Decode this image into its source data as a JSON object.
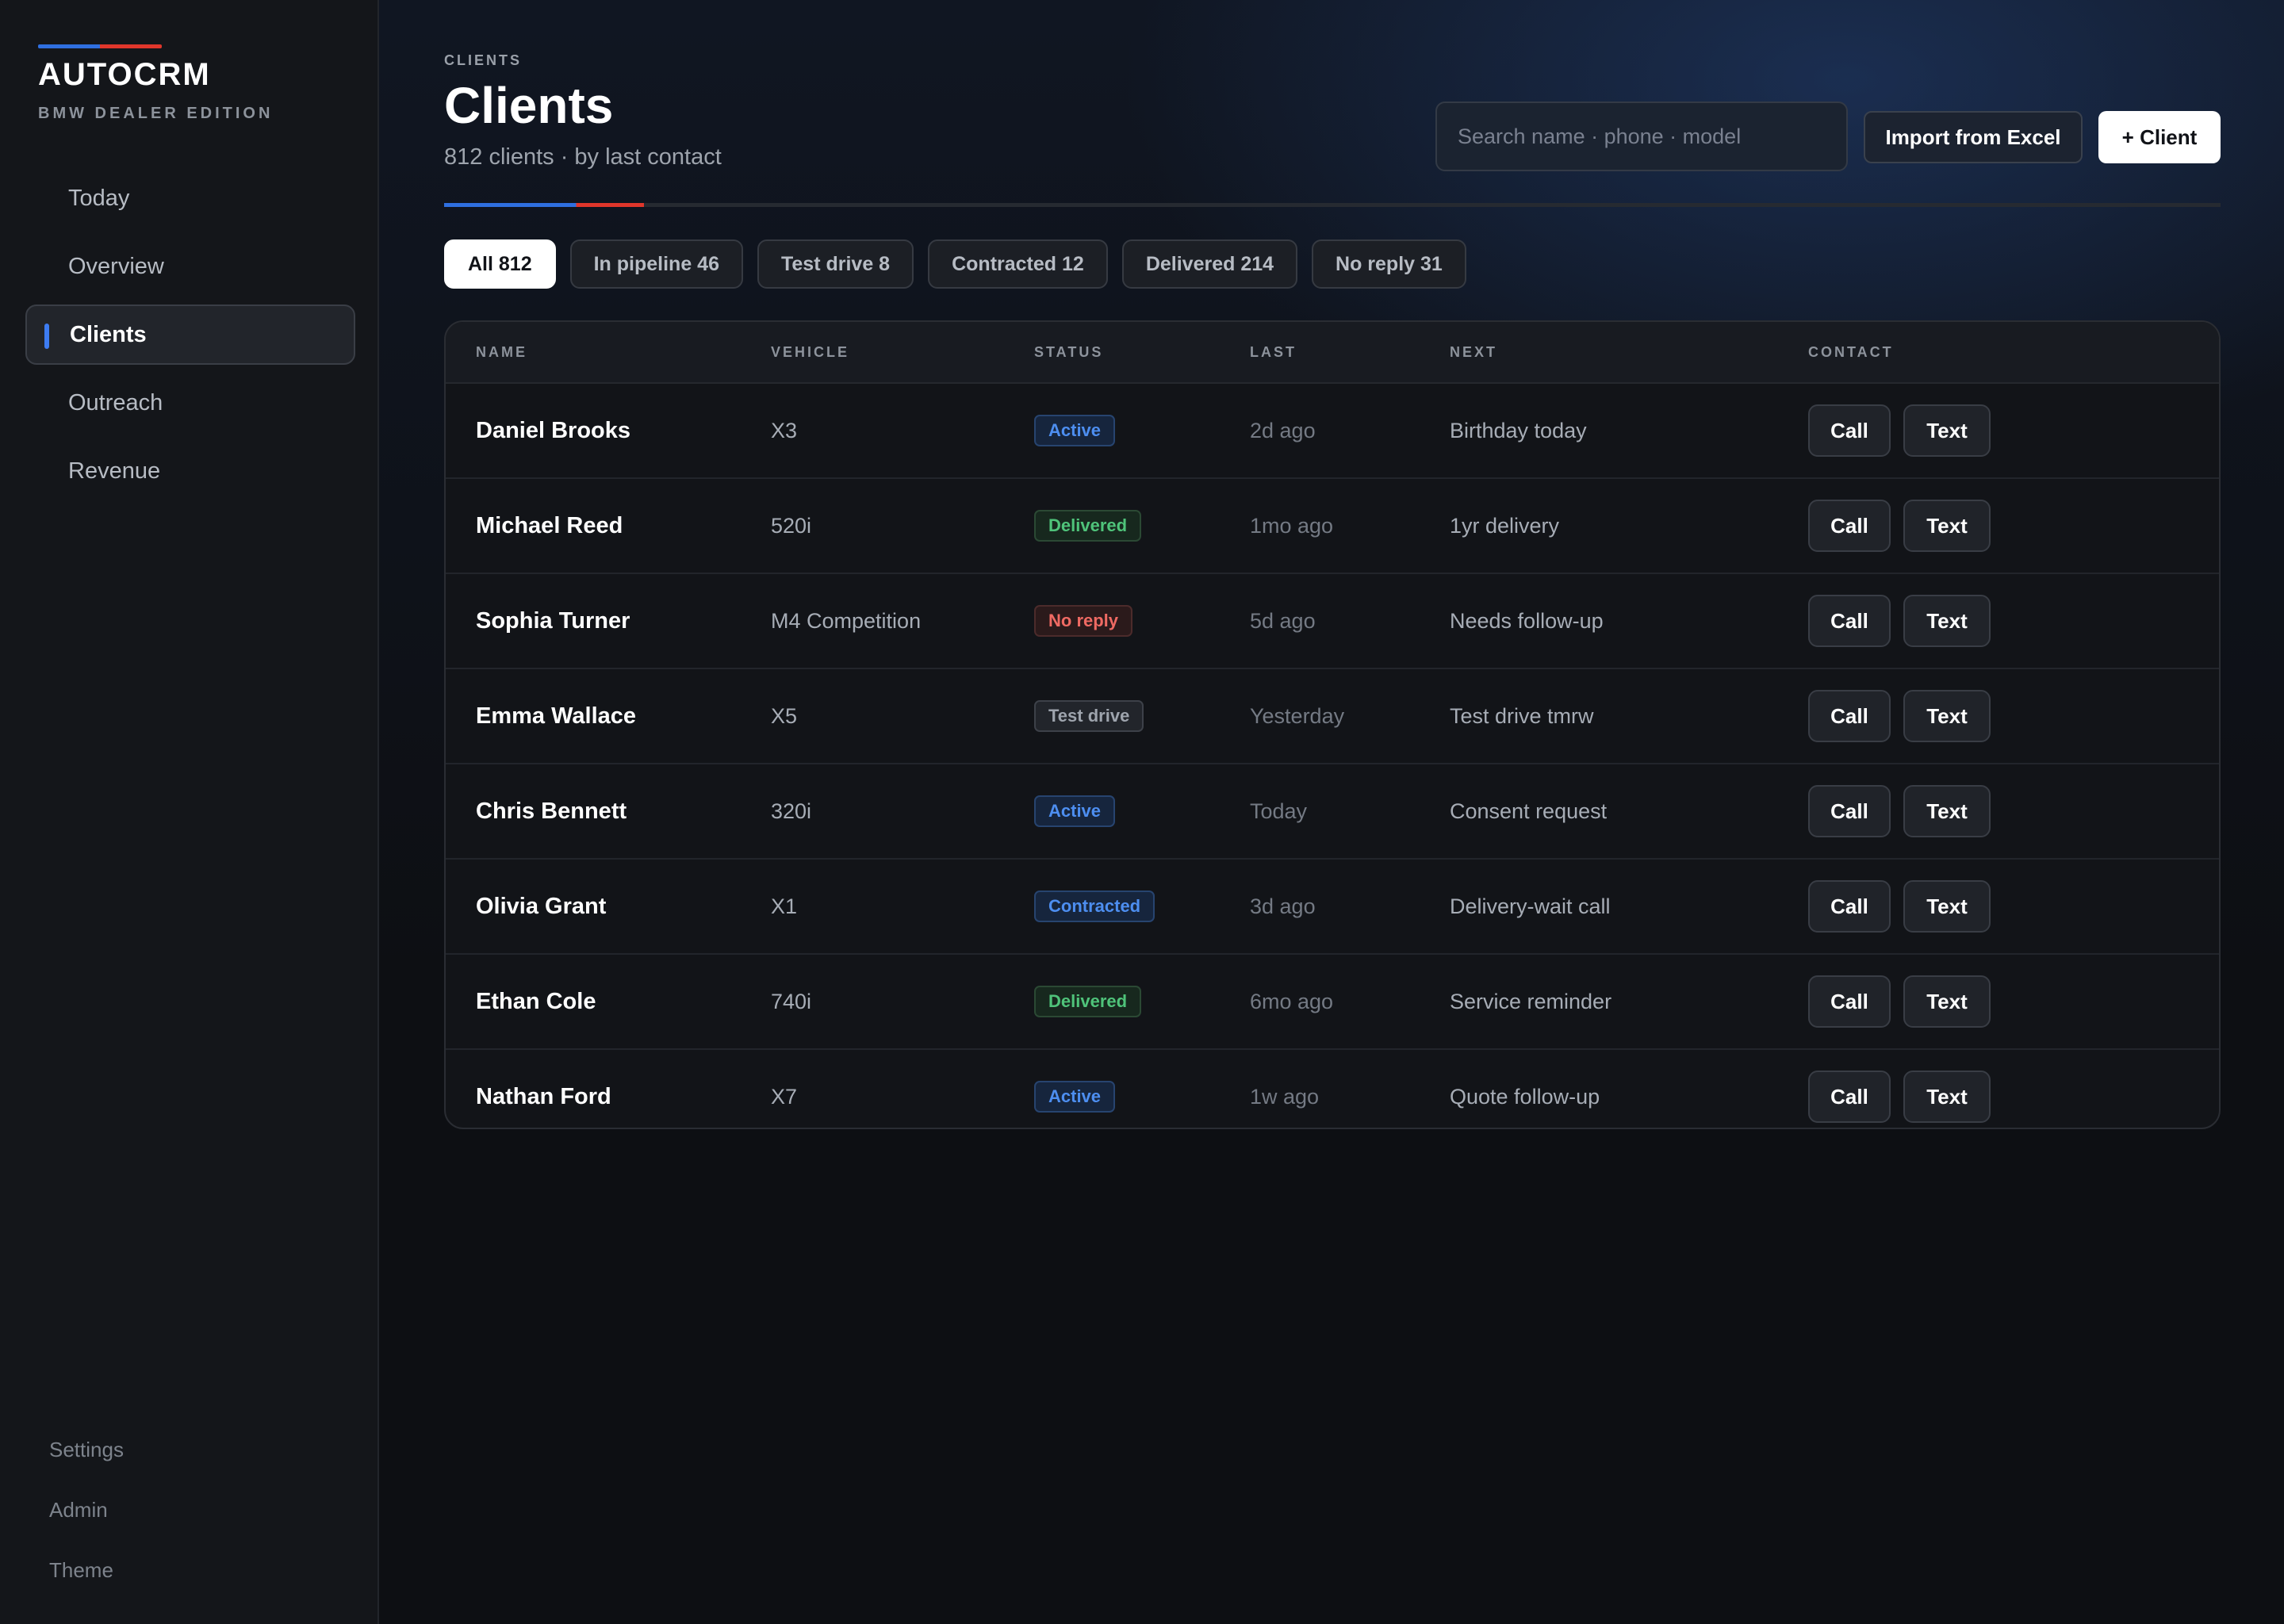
{
  "app": {
    "name": "AUTOCRM",
    "edition": "BMW DEALER EDITION",
    "accent_blue": "#2f6fe0",
    "accent_red": "#e0362b"
  },
  "sidebar": {
    "items": [
      {
        "label": "Today",
        "active": false
      },
      {
        "label": "Overview",
        "active": false
      },
      {
        "label": "Clients",
        "active": true
      },
      {
        "label": "Outreach",
        "active": false
      },
      {
        "label": "Revenue",
        "active": false
      }
    ],
    "bottom": [
      {
        "label": "Settings"
      },
      {
        "label": "Admin"
      },
      {
        "label": "Theme"
      }
    ]
  },
  "header": {
    "breadcrumb": "CLIENTS",
    "title": "Clients",
    "subtitle": "812 clients · by last contact",
    "search_placeholder": "Search name · phone · model",
    "import_label": "Import from Excel",
    "add_label": "+ Client"
  },
  "filters": [
    {
      "label": "All 812",
      "active": true
    },
    {
      "label": "In pipeline 46",
      "active": false
    },
    {
      "label": "Test drive 8",
      "active": false
    },
    {
      "label": "Contracted 12",
      "active": false
    },
    {
      "label": "Delivered 214",
      "active": false
    },
    {
      "label": "No reply 31",
      "active": false
    }
  ],
  "table": {
    "columns": [
      "NAME",
      "VEHICLE",
      "STATUS",
      "LAST",
      "NEXT",
      "CONTACT"
    ],
    "call_label": "Call",
    "text_label": "Text",
    "rows": [
      {
        "name": "Daniel Brooks",
        "vehicle": "X3",
        "status": "Active",
        "status_kind": "active",
        "last": "2d ago",
        "next": "Birthday today"
      },
      {
        "name": "Michael Reed",
        "vehicle": "520i",
        "status": "Delivered",
        "status_kind": "delivered",
        "last": "1mo ago",
        "next": "1yr delivery"
      },
      {
        "name": "Sophia Turner",
        "vehicle": "M4 Competition",
        "status": "No reply",
        "status_kind": "noreply",
        "last": "5d ago",
        "next": "Needs follow-up"
      },
      {
        "name": "Emma Wallace",
        "vehicle": "X5",
        "status": "Test drive",
        "status_kind": "testdrive",
        "last": "Yesterday",
        "next": "Test drive tmrw"
      },
      {
        "name": "Chris Bennett",
        "vehicle": "320i",
        "status": "Active",
        "status_kind": "active",
        "last": "Today",
        "next": "Consent request"
      },
      {
        "name": "Olivia Grant",
        "vehicle": "X1",
        "status": "Contracted",
        "status_kind": "contracted",
        "last": "3d ago",
        "next": "Delivery-wait call"
      },
      {
        "name": "Ethan Cole",
        "vehicle": "740i",
        "status": "Delivered",
        "status_kind": "delivered",
        "last": "6mo ago",
        "next": "Service reminder"
      },
      {
        "name": "Nathan Ford",
        "vehicle": "X7",
        "status": "Active",
        "status_kind": "active",
        "last": "1w ago",
        "next": "Quote follow-up"
      }
    ]
  }
}
